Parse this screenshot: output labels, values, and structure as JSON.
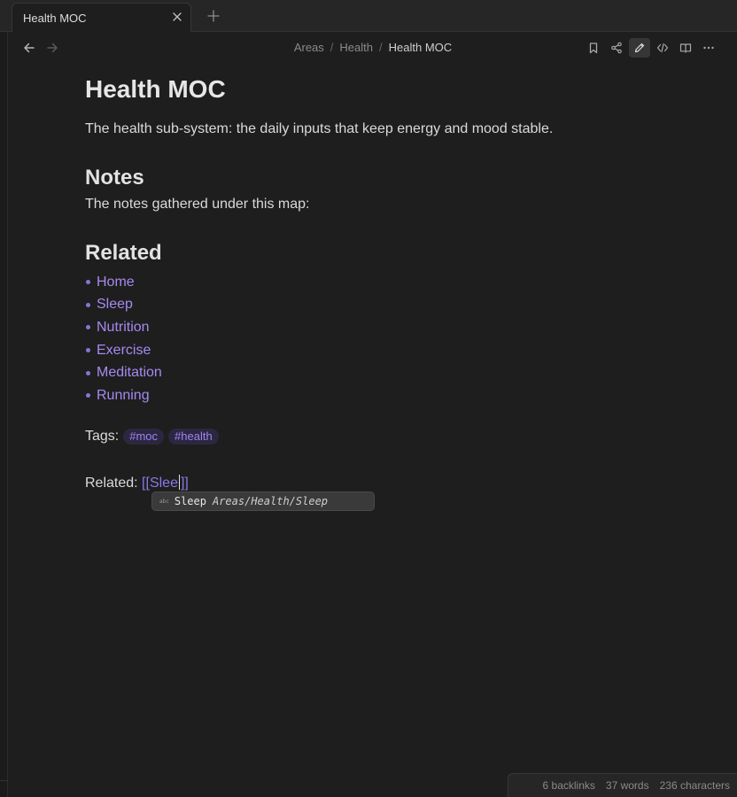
{
  "tab": {
    "title": "Health MOC"
  },
  "breadcrumb": {
    "items": [
      "Areas",
      "Health"
    ],
    "current": "Health MOC",
    "separator": "/"
  },
  "note": {
    "title": "Health MOC",
    "intro": "The health sub-system: the daily inputs that keep energy and mood stable.",
    "notes_heading": "Notes",
    "notes_text": "The notes gathered under this map:",
    "related_heading": "Related",
    "related_links": [
      "Home",
      "Sleep",
      "Nutrition",
      "Exercise",
      "Meditation",
      "Running"
    ],
    "tags_label": "Tags:",
    "tags": [
      "#moc",
      "#health"
    ],
    "related_label": "Related:",
    "related_input_before_caret": "[[Slee",
    "related_input_after_caret": "]]"
  },
  "autocomplete": {
    "name": "Sleep",
    "path": "Areas/Health/Sleep",
    "kind_icon": "text-icon"
  },
  "status": {
    "backlinks": "6 backlinks",
    "words": "37 words",
    "characters": "236 characters"
  },
  "colors": {
    "accent": "#a58af0",
    "tag_bg": "#2c2741",
    "background": "#1e1e1e"
  }
}
